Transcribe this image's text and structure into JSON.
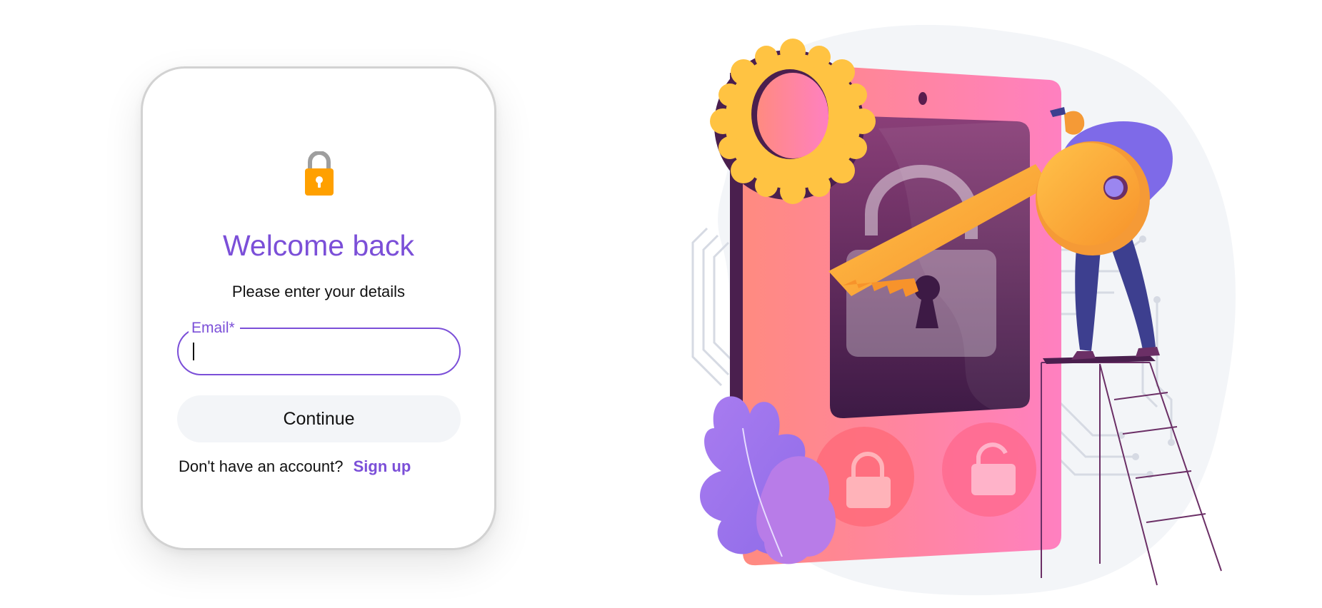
{
  "login": {
    "title": "Welcome back",
    "subtitle": "Please enter your details",
    "email_label": "Email*",
    "email_value": "",
    "continue_label": "Continue",
    "signup_prompt": "Don't have an account?",
    "signup_link": "Sign up"
  },
  "colors": {
    "accent": "#7b4fd8",
    "lock_body": "#ffa000",
    "lock_shackle": "#9e9e9e",
    "button_bg": "#f3f5f8"
  },
  "icons": {
    "card_icon": "padlock-icon",
    "illustration": "phone-lock-illustration"
  }
}
